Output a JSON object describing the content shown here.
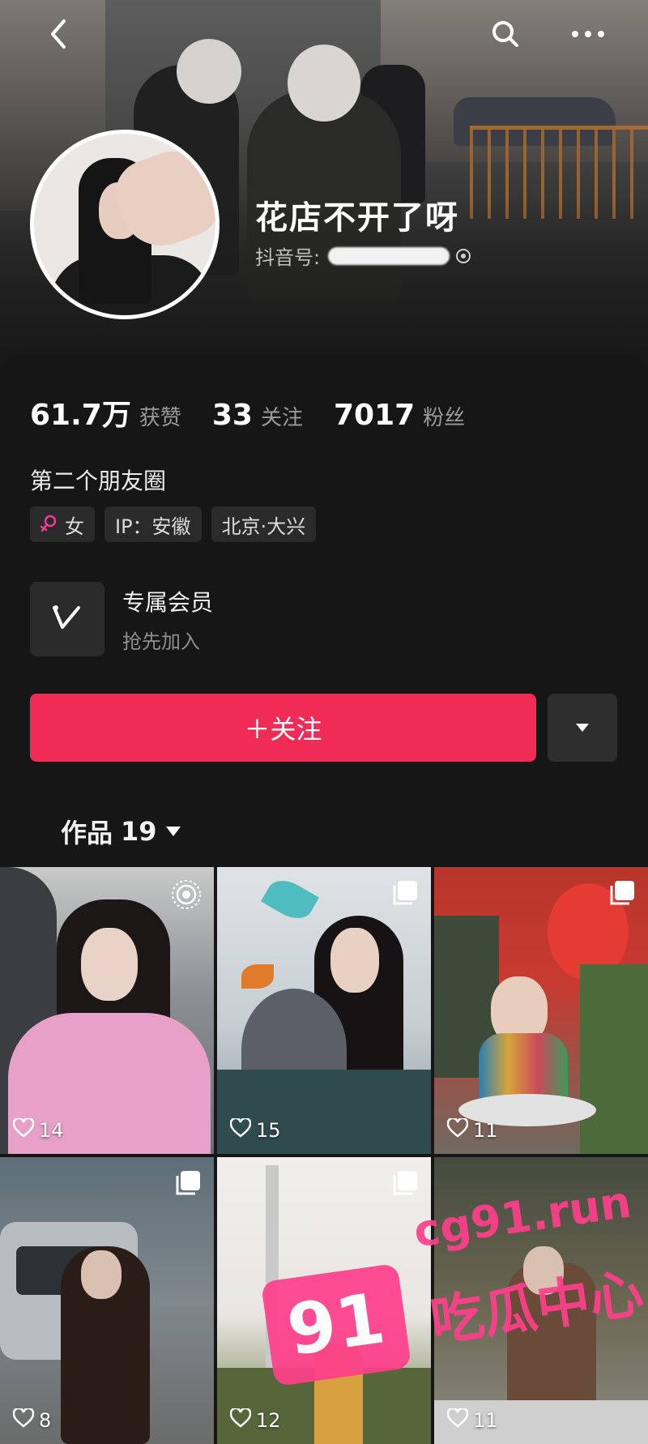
{
  "profile": {
    "nickname": "花店不开了呀",
    "douyin_id_label": "抖音号:"
  },
  "stats": [
    {
      "value": "61.7万",
      "label": "获赞"
    },
    {
      "value": "33",
      "label": "关注"
    },
    {
      "value": "7017",
      "label": "粉丝"
    }
  ],
  "bio": "第二个朋友圈",
  "tags": [
    {
      "text": "女",
      "icon": "female-icon"
    },
    {
      "text": "IP：安徽"
    },
    {
      "text": "北京·大兴"
    }
  ],
  "membership": {
    "title": "专属会员",
    "subtitle": "抢先加入",
    "icon": "v-icon"
  },
  "actions": {
    "follow_label": "＋关注",
    "more_icon": "caret-down-icon"
  },
  "works": {
    "label": "作品",
    "count": "19"
  },
  "grid": [
    {
      "likes": "14",
      "badge": "live-photo-icon"
    },
    {
      "likes": "15",
      "badge": "image-set-icon"
    },
    {
      "likes": "11",
      "badge": "image-set-icon"
    },
    {
      "likes": "8",
      "badge": "image-set-icon"
    },
    {
      "likes": "12",
      "badge": "image-set-icon"
    },
    {
      "likes": "11",
      "badge": ""
    }
  ],
  "watermark": {
    "logo": "91",
    "site": "cg91.run",
    "slogan": "吃瓜中心"
  },
  "colors": {
    "follow": "#f02b55",
    "background": "#161616",
    "watermark": "#ff3f8b"
  }
}
